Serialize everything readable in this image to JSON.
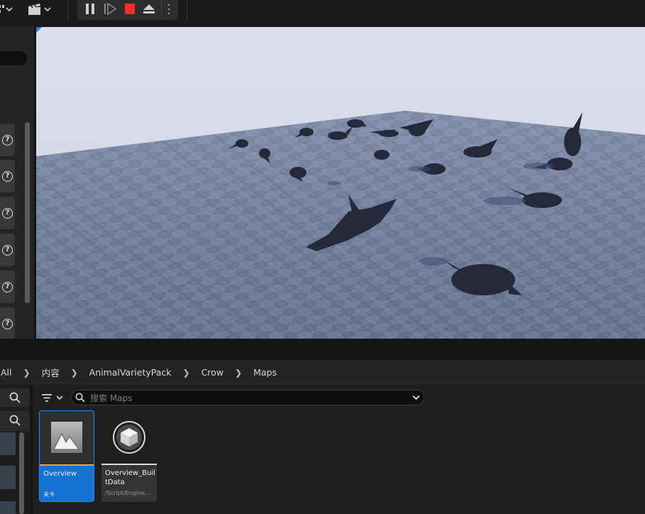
{
  "toolbar": {
    "left_icons": [
      "grid-icon",
      "chevron-down-icon",
      "clapperboard-icon",
      "chevron-down-icon"
    ],
    "play_controls": [
      "pause-icon",
      "step-frame-icon",
      "stop-icon",
      "eject-icon",
      "more-icon"
    ],
    "colors": {
      "stop": "#ff2b2b"
    }
  },
  "details_panel": {
    "help_button_count": 6,
    "help_glyph": "?"
  },
  "viewport": {
    "scene": "crows on a checker floor",
    "accent": "#1e7fe8"
  },
  "breadcrumb": [
    "All",
    "内容",
    "AnimalVarietyPack",
    "Crow",
    "Maps"
  ],
  "content_browser": {
    "search_placeholder": "搜索 Maps",
    "assets": [
      {
        "name": "Overview",
        "type": "关卡",
        "selected": true
      },
      {
        "name": "Overview_BuiltData",
        "type": "/Script/Engine…",
        "selected": false
      }
    ],
    "colors": {
      "selected": "#1572d3",
      "level_stripe": "#e8a33a",
      "data_stripe": "#dcdcdc"
    }
  }
}
